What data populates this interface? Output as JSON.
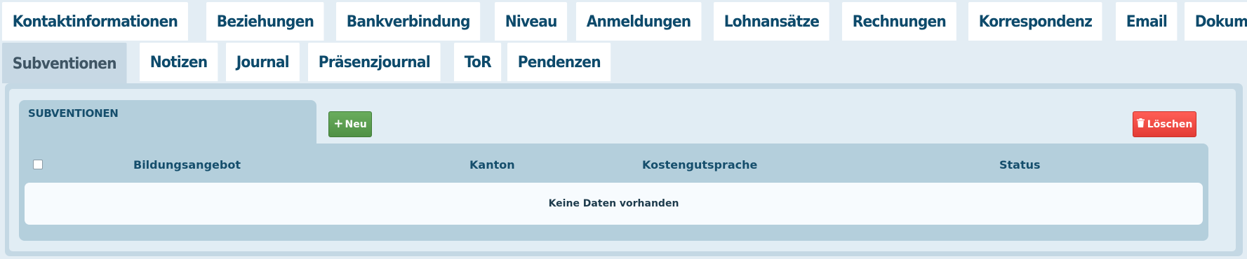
{
  "tabs_row1": [
    {
      "label": "Kontaktinformationen",
      "name": "tab-kontaktinformationen"
    },
    {
      "label": "Beziehungen",
      "name": "tab-beziehungen"
    },
    {
      "label": "Bankverbindung",
      "name": "tab-bankverbindung"
    },
    {
      "label": "Niveau",
      "name": "tab-niveau"
    },
    {
      "label": "Anmeldungen",
      "name": "tab-anmeldungen"
    },
    {
      "label": "Lohnansätze",
      "name": "tab-lohnansaetze"
    },
    {
      "label": "Rechnungen",
      "name": "tab-rechnungen"
    },
    {
      "label": "Korrespondenz",
      "name": "tab-korrespondenz"
    },
    {
      "label": "Email",
      "name": "tab-email"
    },
    {
      "label": "Dokumente",
      "name": "tab-dokumente"
    }
  ],
  "tabs_row2": [
    {
      "label": "Subventionen",
      "name": "tab-subventionen",
      "active": true
    },
    {
      "label": "Notizen",
      "name": "tab-notizen"
    },
    {
      "label": "Journal",
      "name": "tab-journal"
    },
    {
      "label": "Präsenzjournal",
      "name": "tab-praesenzjournal"
    },
    {
      "label": "ToR",
      "name": "tab-tor"
    },
    {
      "label": "Pendenzen",
      "name": "tab-pendenzen"
    }
  ],
  "section": {
    "title": "SUBVENTIONEN"
  },
  "toolbar": {
    "new_icon": "plus-icon",
    "new_label": "Neu",
    "delete_icon": "trash-icon",
    "delete_label": "Löschen"
  },
  "grid": {
    "columns": [
      "Bildungsangebot",
      "Kanton",
      "Kostengutsprache",
      "Status"
    ],
    "empty_message": "Keine Daten vorhanden",
    "select_all_checked": false
  },
  "colors": {
    "tab_text": "#0d4a6b",
    "active_tab_bg": "#c7d8e4",
    "new_button": "#5a9e50",
    "delete_button": "#f04a42"
  }
}
